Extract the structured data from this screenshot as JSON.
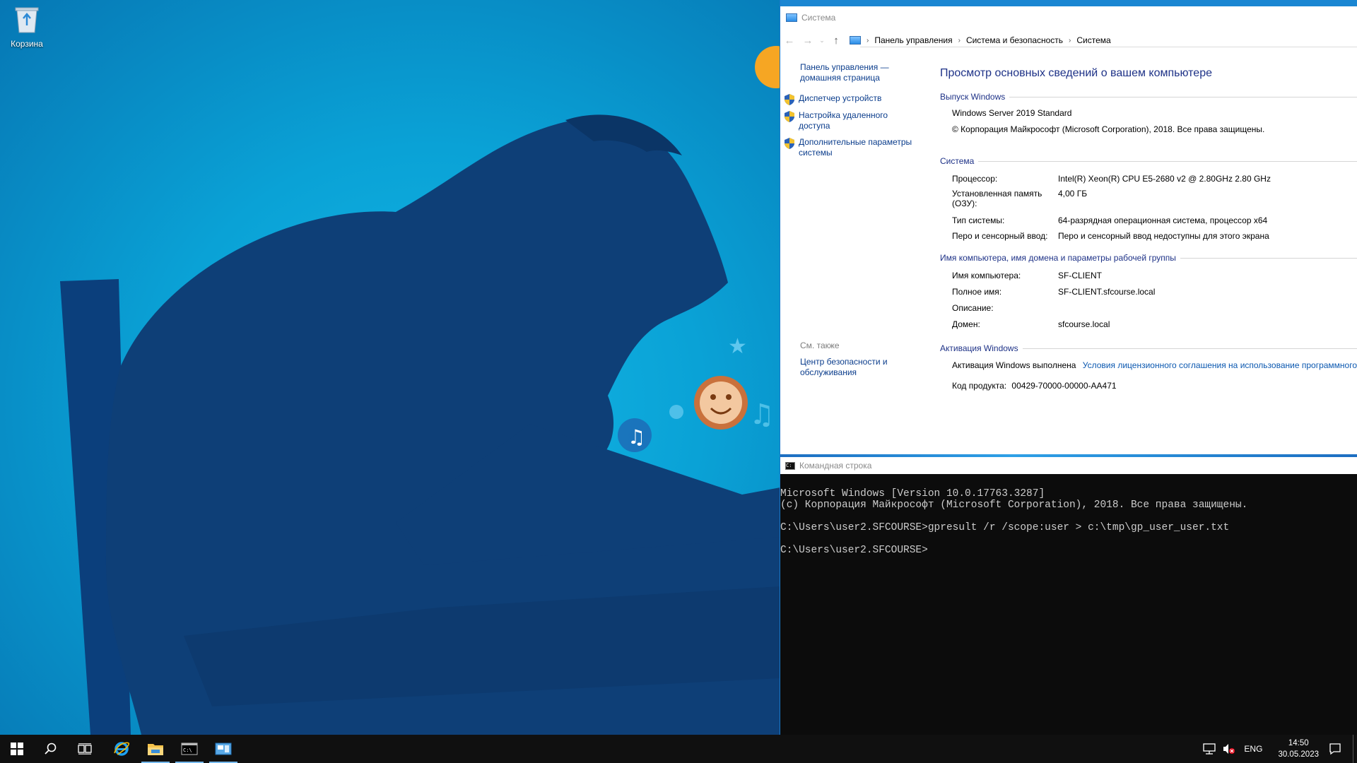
{
  "desktop": {
    "recycle_bin_label": "Корзина"
  },
  "system_window": {
    "title": "Система",
    "breadcrumbs": [
      "Панель управления",
      "Система и безопасность",
      "Система"
    ],
    "sidebar": {
      "home_link": "Панель управления — домашняя страница",
      "items": [
        {
          "label": "Диспетчер устройств",
          "icon": "shield-icon"
        },
        {
          "label": "Настройка удаленного доступа",
          "icon": "shield-icon"
        },
        {
          "label": "Дополнительные параметры системы",
          "icon": "shield-icon"
        }
      ],
      "see_also_label": "См. также",
      "security_center_link": "Центр безопасности и обслуживания"
    },
    "main_title": "Просмотр основных сведений о вашем компьютере",
    "windows_edition": {
      "section_title": "Выпуск Windows",
      "edition": "Windows Server 2019 Standard",
      "copyright": "© Корпорация Майкрософт (Microsoft Corporation), 2018. Все права защищены."
    },
    "system": {
      "section_title": "Система",
      "processor_label": "Процессор:",
      "processor_value": "Intel(R) Xeon(R) CPU E5-2680 v2 @ 2.80GHz   2.80 GHz",
      "ram_label": "Установленная память (ОЗУ):",
      "ram_value": "4,00 ГБ",
      "type_label": "Тип системы:",
      "type_value": "64-разрядная операционная система, процессор x64",
      "pen_label": "Перо и сенсорный ввод:",
      "pen_value": "Перо и сенсорный ввод недоступны для этого экрана"
    },
    "computer_name": {
      "section_title": "Имя компьютера, имя домена и параметры рабочей группы",
      "name_label": "Имя компьютера:",
      "name_value": "SF-CLIENT",
      "full_label": "Полное имя:",
      "full_value": "SF-CLIENT.sfcourse.local",
      "desc_label": "Описание:",
      "desc_value": "",
      "domain_label": "Домен:",
      "domain_value": "sfcourse.local"
    },
    "activation": {
      "section_title": "Активация Windows",
      "status": "Активация Windows выполнена",
      "license_link": "Условия лицензионного соглашения на использование программного",
      "product_key_label": "Код продукта:",
      "product_key_value": "00429-70000-00000-AA471"
    }
  },
  "cmd_window": {
    "title": "Командная строка",
    "lines": [
      "Microsoft Windows [Version 10.0.17763.3287]",
      "(c) Корпорация Майкрософт (Microsoft Corporation), 2018. Все права защищены.",
      "",
      "C:\\Users\\user2.SFCOURSE>gpresult /r /scope:user > c:\\tmp\\gp_user_user.txt",
      "",
      "C:\\Users\\user2.SFCOURSE>"
    ]
  },
  "taskbar": {
    "language": "ENG",
    "time": "14:50",
    "date": "30.05.2023",
    "accent_color": "#76b9ed"
  }
}
